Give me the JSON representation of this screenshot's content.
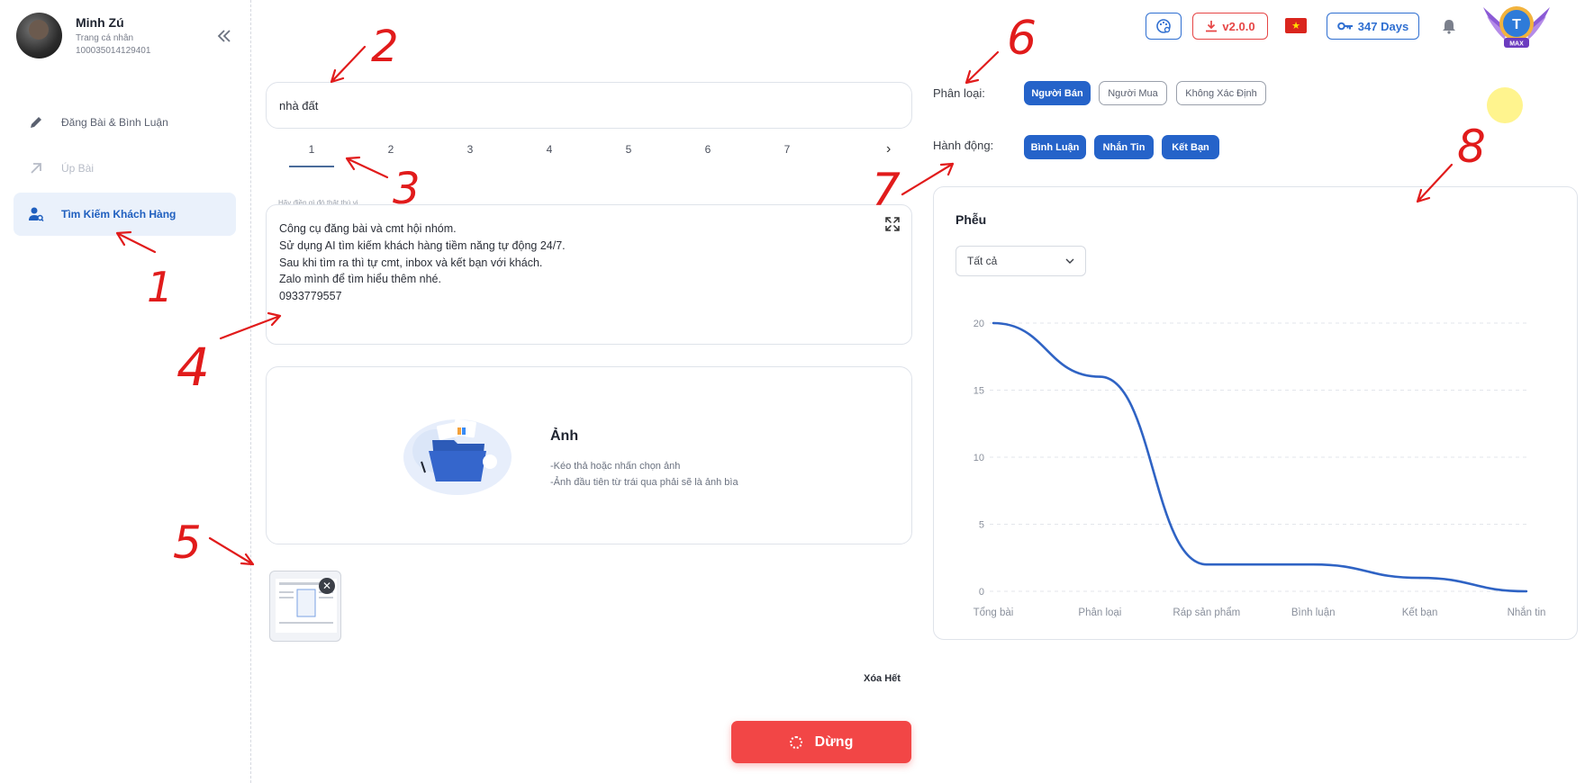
{
  "profile": {
    "name": "Minh Zú",
    "subtitle": "Trang cá nhân",
    "id": "100035014129401"
  },
  "sidebar": {
    "items": [
      {
        "label": "Đăng Bài & Bình Luận",
        "icon": "pencil-icon",
        "state": "normal"
      },
      {
        "label": "Úp Bài",
        "icon": "arrow-up-right-icon",
        "state": "disabled"
      },
      {
        "label": "Tìm Kiếm Khách Hàng",
        "icon": "user-search-icon",
        "state": "active"
      }
    ]
  },
  "topbar": {
    "version": "v2.0.0",
    "days": "347 Days",
    "badge_letter": "T",
    "badge_tier": "MAX",
    "flag": "★"
  },
  "search": {
    "value": "nhà đất"
  },
  "pagination": {
    "pages": [
      "1",
      "2",
      "3",
      "4",
      "5",
      "6",
      "7"
    ],
    "active": "1",
    "next": "›"
  },
  "message": {
    "label": "Hãy điền gì đó thật thú vị...",
    "lines": [
      "Công cụ đăng bài và cmt hội nhóm.",
      "Sử dụng AI tìm kiếm khách hàng tiềm năng tự động 24/7.",
      "Sau khi tìm ra thì tự cmt, inbox và kết bạn với khách.",
      "Zalo mình để tìm hiểu thêm nhé.",
      "0933779557"
    ]
  },
  "dropzone": {
    "title": "Ảnh",
    "hint1": "-Kéo thả hoặc nhấn chọn ảnh",
    "hint2": "-Ảnh đầu tiên từ trái qua phải sẽ là ảnh bìa"
  },
  "actions": {
    "clear_all": "Xóa Hết",
    "stop": "Dừng"
  },
  "filters": {
    "category_label": "Phân loại:",
    "categories": [
      {
        "label": "Người Bán",
        "on": true
      },
      {
        "label": "Người Mua",
        "on": false
      },
      {
        "label": "Không Xác Định",
        "on": false
      }
    ],
    "action_label": "Hành động:",
    "actions": [
      {
        "label": "Bình Luận",
        "on": true
      },
      {
        "label": "Nhắn Tin",
        "on": true
      },
      {
        "label": "Kết Bạn",
        "on": true
      }
    ]
  },
  "funnel": {
    "title": "Phễu",
    "select_value": "Tất cả"
  },
  "chart_data": {
    "type": "line",
    "categories": [
      "Tổng bài",
      "Phân loại",
      "Ráp sản phẩm",
      "Bình luận",
      "Kết bạn",
      "Nhắn tin"
    ],
    "values": [
      20,
      16,
      2,
      2,
      1,
      0
    ],
    "ylim": [
      0,
      20
    ],
    "yticks": [
      0,
      5,
      10,
      15,
      20
    ],
    "grid": true,
    "line_color": "#2f63c4"
  },
  "annotations": [
    "1",
    "2",
    "3",
    "4",
    "5",
    "6",
    "7",
    "8"
  ],
  "colors": {
    "accent": "#2563c9",
    "danger": "#f24646",
    "annotation": "#e11b1b"
  }
}
